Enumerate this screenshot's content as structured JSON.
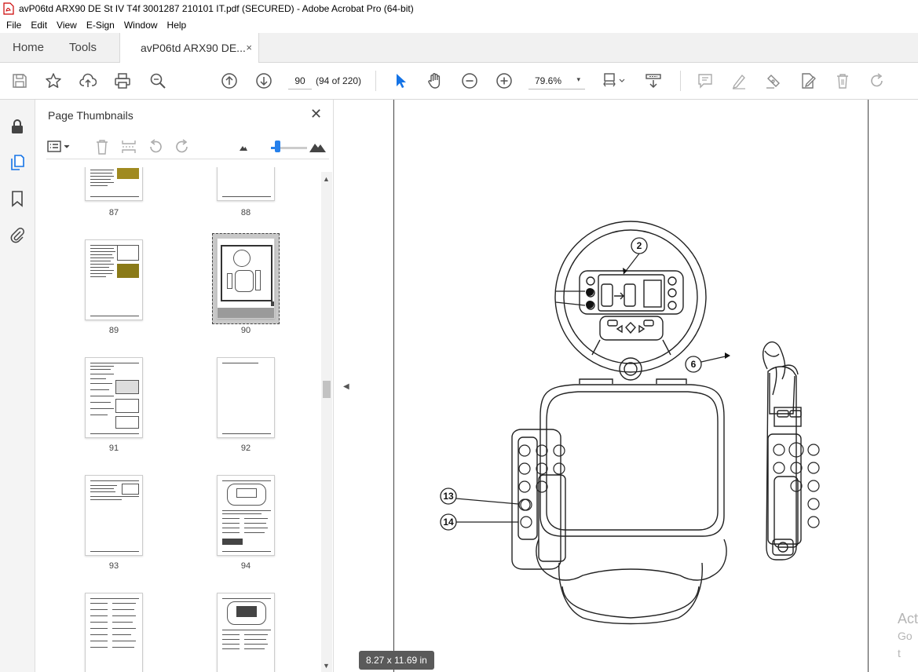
{
  "window": {
    "title": "avP06td ARX90 DE St IV T4f 3001287 210101 IT.pdf (SECURED) - Adobe Acrobat Pro (64-bit)"
  },
  "menu": [
    "File",
    "Edit",
    "View",
    "E-Sign",
    "Window",
    "Help"
  ],
  "tabs": {
    "home": "Home",
    "tools": "Tools",
    "document": "avP06td ARX90 DE...",
    "close": "×"
  },
  "toolbar": {
    "page_number": "90",
    "page_count": "(94 of 220)",
    "zoom": "79.6%",
    "zoom_caret": "▾",
    "accent_color": "#1473e6"
  },
  "panel": {
    "title": "Page Thumbnails",
    "close": "✕",
    "thumbnail_size_fraction": 0.15,
    "thumbnails": [
      {
        "label": "87"
      },
      {
        "label": "88"
      },
      {
        "label": "89"
      },
      {
        "label": "90",
        "selected": true
      },
      {
        "label": "91"
      },
      {
        "label": "92"
      },
      {
        "label": "93"
      },
      {
        "label": "94"
      }
    ]
  },
  "page": {
    "size_tooltip": "8.27 x 11.69 in",
    "callouts": [
      "2",
      "6",
      "13",
      "14"
    ]
  },
  "watermark": {
    "line1": "Act",
    "line2": "Go t"
  }
}
